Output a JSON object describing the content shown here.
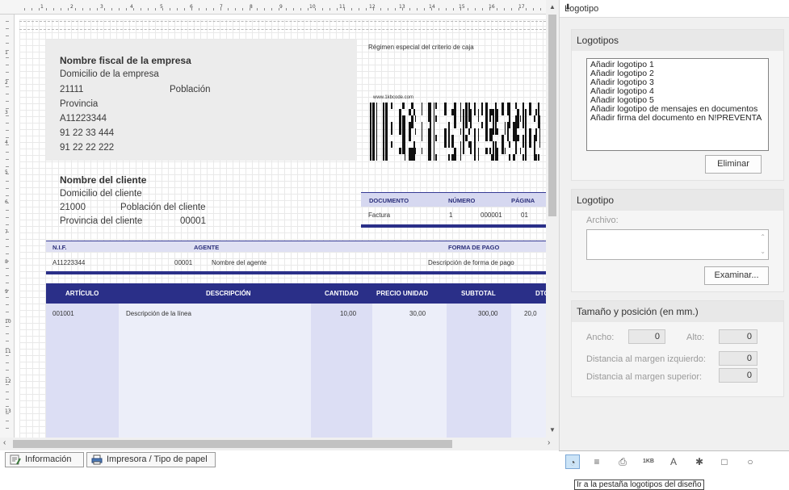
{
  "designer": {
    "company": {
      "name": "Nombre fiscal de la empresa",
      "address": "Domicilio de la empresa",
      "postal_code": "21111",
      "town": "Población",
      "province": "Provincia",
      "nif": "A11223344",
      "phone": "91 22 33 444",
      "fax": "91 22 22 222"
    },
    "regimen": "Régimen especial del criterio de caja",
    "barcode_url": "www.1kbcode.com",
    "client": {
      "name": "Nombre del cliente",
      "address": "Domicilio del cliente",
      "postal_code": "21000",
      "town": "Población del cliente",
      "province": "Provincia del cliente",
      "code": "00001"
    },
    "doc_table": {
      "headers": [
        "DOCUMENTO",
        "NÚMERO",
        "PÁGINA"
      ],
      "type": "Factura",
      "serie": "1",
      "number": "000001",
      "page": "01"
    },
    "nif_table": {
      "headers": [
        "N.I.F.",
        "AGENTE",
        "FORMA DE PAGO"
      ],
      "nif": "A11223344",
      "agent_code": "00001",
      "agent_name": "Nombre del agente",
      "payment": "Descripción de forma de pago"
    },
    "lines_table": {
      "headers": [
        "ARTÍCULO",
        "DESCRIPCIÓN",
        "CANTIDAD",
        "PRECIO UNIDAD",
        "SUBTOTAL",
        "DTO"
      ],
      "row": [
        "001001",
        "Descripción de la línea",
        "10,00",
        "30,00",
        "300,00",
        "20,0"
      ]
    },
    "ruler_top": [
      "1",
      "2",
      "3",
      "4",
      "5",
      "6",
      "7",
      "8",
      "9",
      "10",
      "11",
      "12",
      "13",
      "14",
      "15",
      "16",
      "17"
    ],
    "ruler_left": [
      "1",
      "2",
      "3",
      "4",
      "5",
      "6",
      "7",
      "8",
      "9",
      "10",
      "11",
      "12",
      "13",
      "14"
    ]
  },
  "bottom_tabs": {
    "info": "Información",
    "printer": "Impresora / Tipo de papel"
  },
  "panel": {
    "title": "Logotipo",
    "pin": "⬇",
    "logos_group": {
      "title": "Logotipos",
      "items": [
        "Añadir logotipo 1",
        "Añadir logotipo 2",
        "Añadir logotipo 3",
        "Añadir logotipo 4",
        "Añadir logotipo 5",
        "Añadir logotipo de mensajes en documentos",
        "Añadir firma del documento en N!PREVENTA"
      ],
      "delete_button": "Eliminar"
    },
    "logo_group": {
      "title": "Logotipo",
      "file_label": "Archivo:",
      "file_value": "",
      "browse_button": "Examinar..."
    },
    "size_group": {
      "title": "Tamaño y posición (en mm.)",
      "width_label": "Ancho:",
      "width_value": "0",
      "height_label": "Alto:",
      "height_value": "0",
      "left_margin_label": "Distancia al margen izquierdo:",
      "left_margin_value": "0",
      "top_margin_label": "Distancia al margen superior:",
      "top_margin_value": "0"
    },
    "tabs": [
      "logo-tab",
      "text-tab",
      "printer-tab",
      "barcode-tab",
      "font-tab",
      "line-tab",
      "rectangle-tab",
      "ellipse-tab"
    ],
    "tab_glyphs": [
      "◔",
      "≡",
      "⎙",
      "1KB",
      "A",
      "✱",
      "□",
      "○"
    ],
    "active_tab": "logo-tab"
  },
  "tooltip": "Ir a la pestaña logotipos del diseño",
  "colors": {
    "accent": "#2a2f88",
    "header_light": "#d6d8f0",
    "column_fill": "#dcdef4",
    "company_box": "#ececec",
    "panel_bg": "#f0f0f0"
  }
}
